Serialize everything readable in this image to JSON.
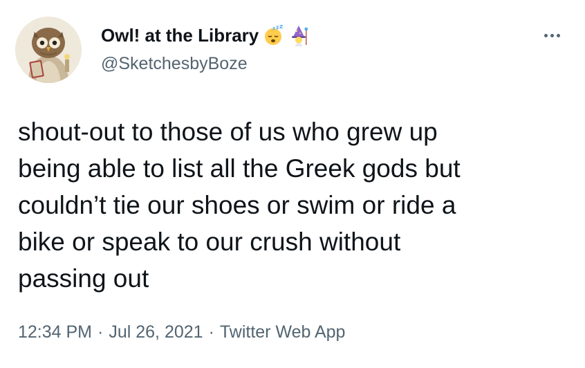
{
  "author": {
    "display_name": "Owl! at the Library",
    "handle": "@SketchesbyBoze",
    "name_emojis": [
      "sleeping-face-emoji",
      "mage-emoji"
    ],
    "avatar_icon": "owl-reading-book-avatar"
  },
  "menu": {
    "icon": "more-options-icon"
  },
  "tweet": {
    "text": "shout-out to those of us who grew up\nbeing able to list all the Greek gods but\ncouldn’t tie our shoes or swim or ride a\nbike or speak to our crush without\npassing out"
  },
  "meta": {
    "time": "12:34 PM",
    "separator": "·",
    "date": "Jul 26, 2021",
    "source": "Twitter Web App"
  },
  "colors": {
    "text_primary": "#0f1419",
    "text_secondary": "#536471",
    "background": "#ffffff"
  }
}
